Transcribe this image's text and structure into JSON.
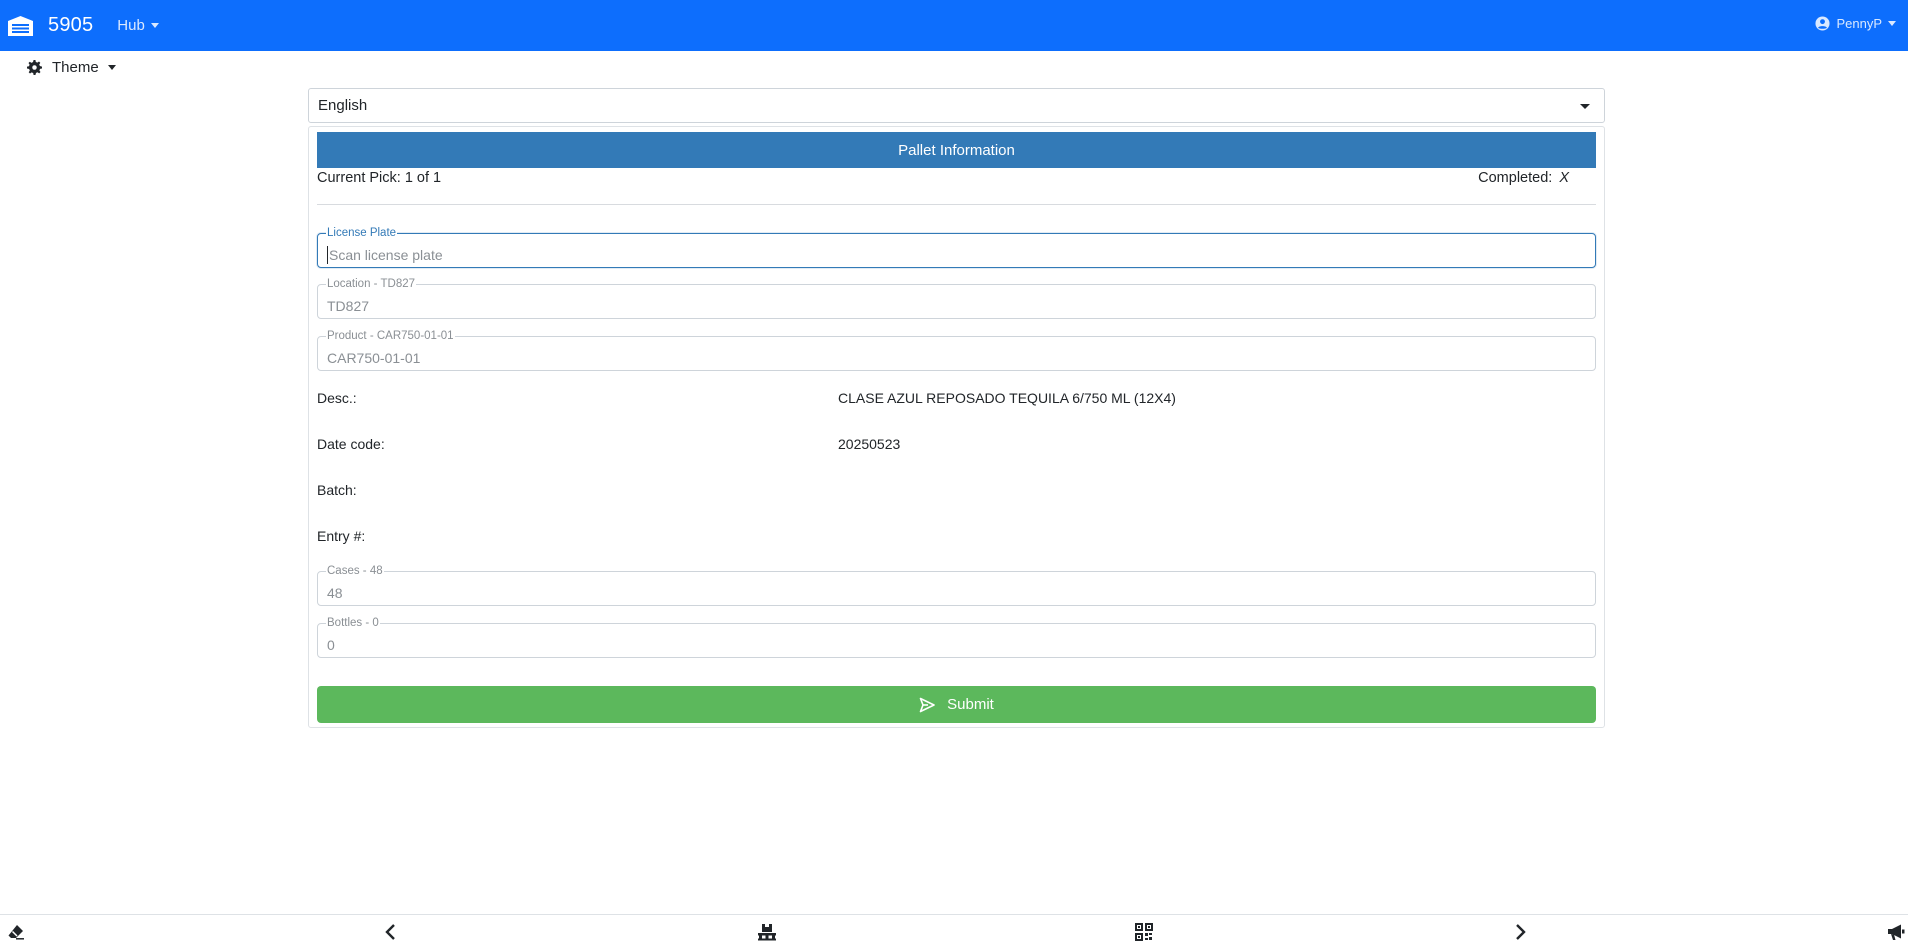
{
  "navbar": {
    "brand_number": "5905",
    "hub_label": "Hub",
    "user_label": "PennyP",
    "bg_color": "#0d6efd"
  },
  "theme": {
    "label": "Theme"
  },
  "language": {
    "selected": "English"
  },
  "card": {
    "header": "Pallet Information",
    "current_pick": "Current Pick: 1 of 1",
    "completed_label": "Completed:",
    "completed_value": "X",
    "header_color": "#337ab7"
  },
  "fields": {
    "license_plate": {
      "label": "License Plate",
      "placeholder": "Scan license plate",
      "value": ""
    },
    "location": {
      "label": "Location - TD827",
      "value": "TD827"
    },
    "product": {
      "label": "Product - CAR750-01-01",
      "value": "CAR750-01-01"
    },
    "cases": {
      "label": "Cases - 48",
      "value": "48"
    },
    "bottles": {
      "label": "Bottles - 0",
      "value": "0"
    }
  },
  "info": {
    "desc_label": "Desc.:",
    "desc_value": "CLASE AZUL REPOSADO TEQUILA 6/750 ML (12X4)",
    "date_code_label": "Date code:",
    "date_code_value": "20250523",
    "batch_label": "Batch:",
    "batch_value": "",
    "entry_label": "Entry #:",
    "entry_value": ""
  },
  "submit": {
    "label": "Submit",
    "color": "#5cb85c"
  },
  "bottom_bar": {
    "icons": [
      "eraser-icon",
      "chevron-left-icon",
      "pallet-icon",
      "qr-code-icon",
      "chevron-right-icon",
      "megaphone-icon"
    ]
  }
}
